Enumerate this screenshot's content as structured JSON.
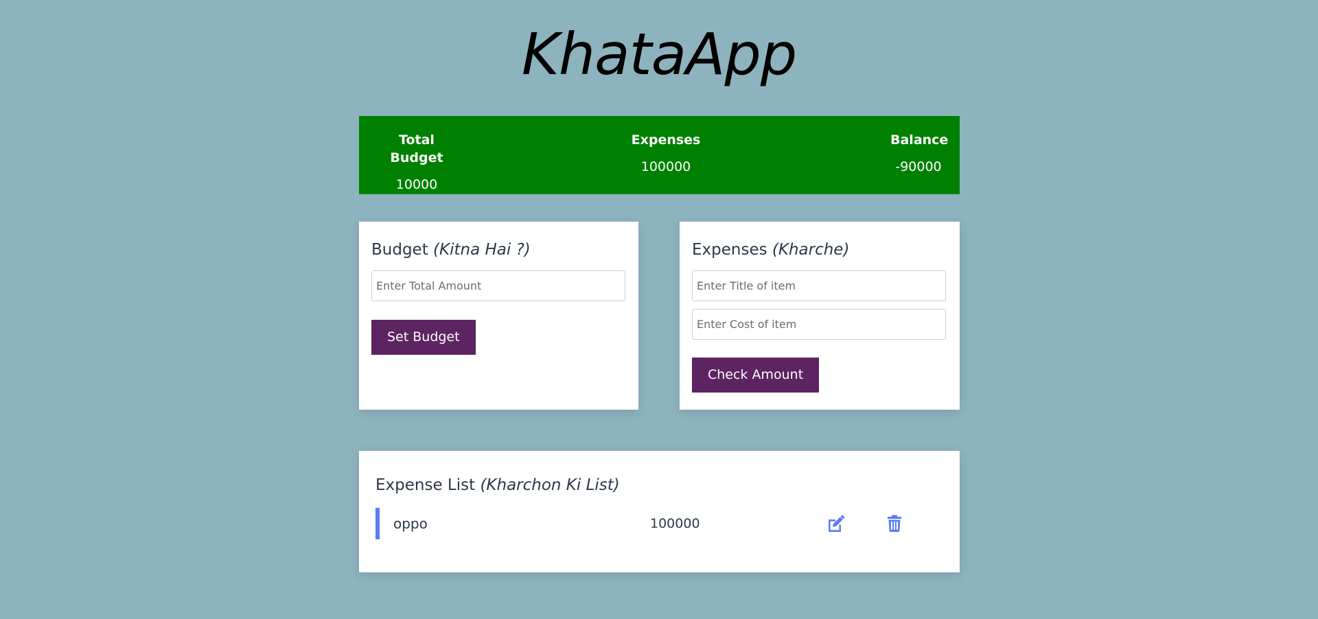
{
  "app": {
    "title": "KhataApp"
  },
  "summary": {
    "total_budget_label": "Total Budget",
    "total_budget_value": "10000",
    "expenses_label": "Expenses",
    "expenses_value": "100000",
    "balance_label": "Balance",
    "balance_value": "-90000",
    "background_color": "#008000"
  },
  "budget_card": {
    "title": "Budget",
    "subtitle": "(Kitna Hai ?)",
    "amount_placeholder": "Enter Total Amount",
    "button_label": "Set Budget"
  },
  "expense_card": {
    "title": "Expenses",
    "subtitle": "(Kharche)",
    "title_placeholder": "Enter Title of item",
    "cost_placeholder": "Enter Cost of item",
    "button_label": "Check Amount"
  },
  "expense_list": {
    "title": "Expense List",
    "subtitle": "(Kharchon Ki List)",
    "items": [
      {
        "name": "oppo",
        "cost": "100000",
        "edit_icon": "edit-icon",
        "delete_icon": "trash-icon"
      }
    ]
  },
  "colors": {
    "page_background": "#8db3bf",
    "button_background": "#5c2460",
    "accent_blue": "#5a7cf0"
  }
}
